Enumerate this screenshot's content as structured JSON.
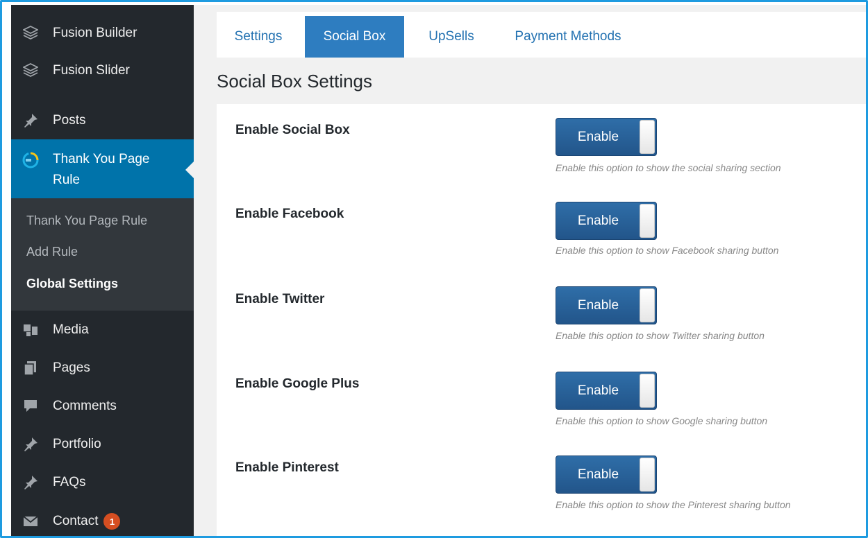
{
  "sidebar": {
    "items": [
      {
        "label": "Fusion Builder",
        "icon": "fusion-icon"
      },
      {
        "label": "Fusion Slider",
        "icon": "fusion-icon"
      },
      {
        "label": "Posts",
        "icon": "pin-icon"
      },
      {
        "label": "Thank You Page Rule",
        "icon": "thankyou-icon"
      },
      {
        "label": "Media",
        "icon": "media-icon"
      },
      {
        "label": "Pages",
        "icon": "pages-icon"
      },
      {
        "label": "Comments",
        "icon": "comment-icon"
      },
      {
        "label": "Portfolio",
        "icon": "pin-icon"
      },
      {
        "label": "FAQs",
        "icon": "pin-icon"
      },
      {
        "label": "Contact",
        "icon": "mail-icon",
        "badge": "1"
      }
    ],
    "active_label_line1": "Thank You Page",
    "active_label_line2": "Rule",
    "submenu": [
      "Thank You Page Rule",
      "Add Rule",
      "Global Settings"
    ],
    "current_submenu": "Global Settings"
  },
  "tabs": [
    "Settings",
    "Social Box",
    "UpSells",
    "Payment Methods"
  ],
  "active_tab": "Social Box",
  "section_title": "Social Box Settings",
  "settings": [
    {
      "label": "Enable Social Box",
      "toggle": "Enable",
      "description": "Enable this option to show the social sharing section"
    },
    {
      "label": "Enable Facebook",
      "toggle": "Enable",
      "description": "Enable this option to show Facebook sharing button"
    },
    {
      "label": "Enable Twitter",
      "toggle": "Enable",
      "description": "Enable this option to show Twitter sharing button"
    },
    {
      "label": "Enable Google Plus",
      "toggle": "Enable",
      "description": "Enable this option to show Google sharing button"
    },
    {
      "label": "Enable Pinterest",
      "toggle": "Enable",
      "description": "Enable this option to show the Pinterest sharing button"
    }
  ],
  "colors": {
    "sidebar_bg": "#23282d",
    "active_menu": "#0073aa",
    "tab_active": "#2e7dc0",
    "frame_border": "#1e9be0"
  }
}
